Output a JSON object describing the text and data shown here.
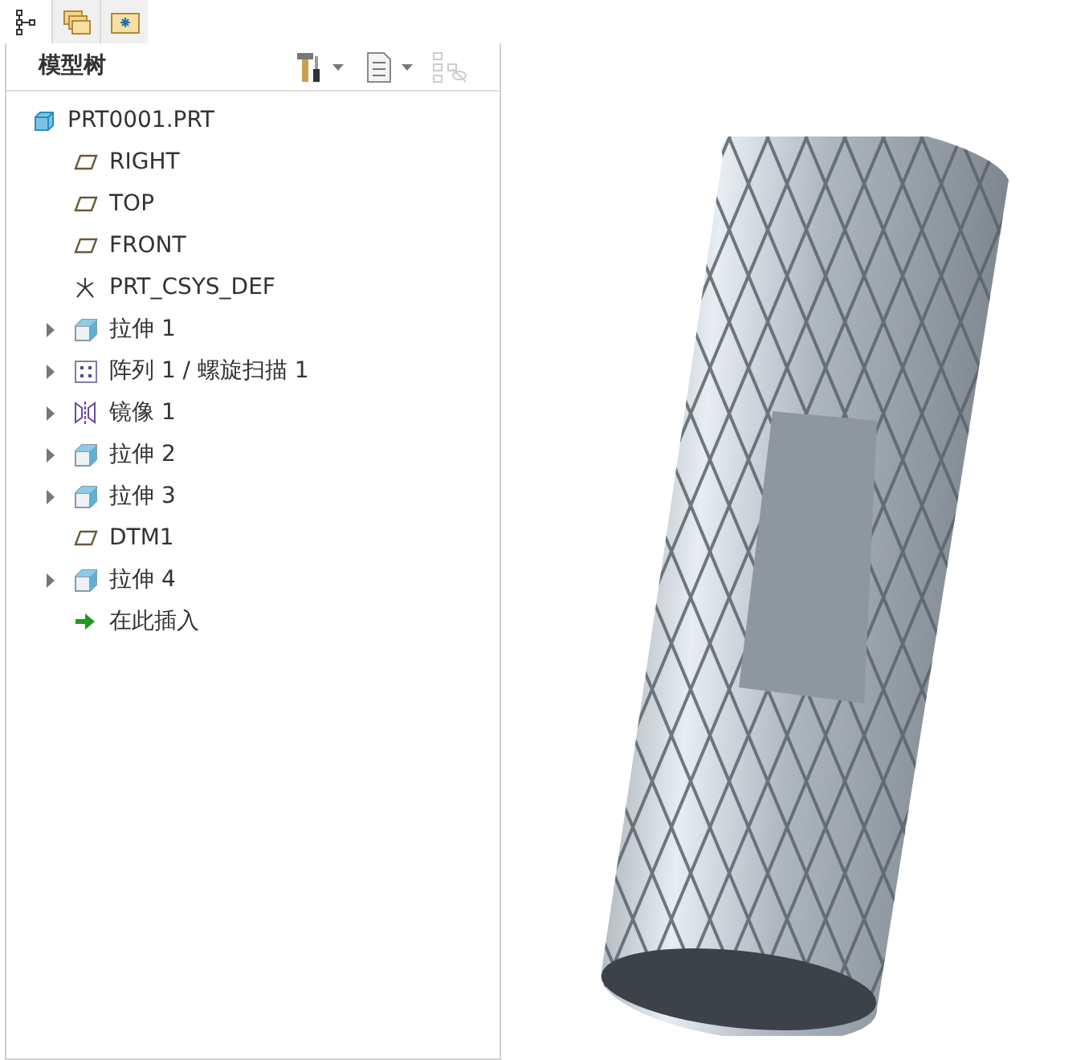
{
  "panel_tabs": [
    {
      "kind": "tree",
      "selected": true
    },
    {
      "kind": "layers",
      "selected": false
    },
    {
      "kind": "favorites",
      "selected": false
    }
  ],
  "model_tree": {
    "title": "模型树",
    "items": [
      {
        "kind": "part",
        "label": "PRT0001.PRT",
        "children": [
          {
            "kind": "plane",
            "label": "RIGHT"
          },
          {
            "kind": "plane",
            "label": "TOP"
          },
          {
            "kind": "plane",
            "label": "FRONT"
          },
          {
            "kind": "csys",
            "label": "PRT_CSYS_DEF"
          },
          {
            "kind": "extrude",
            "label": "拉伸 1",
            "expanded": false
          },
          {
            "kind": "pattern",
            "label": "阵列 1 / 螺旋扫描 1",
            "expanded": false
          },
          {
            "kind": "mirror",
            "label": "镜像 1",
            "expanded": false
          },
          {
            "kind": "extrude",
            "label": "拉伸 2",
            "expanded": false
          },
          {
            "kind": "extrude",
            "label": "拉伸 3",
            "expanded": false
          },
          {
            "kind": "plane",
            "label": "DTM1"
          },
          {
            "kind": "extrude",
            "label": "拉伸 4",
            "expanded": false
          },
          {
            "kind": "insert",
            "label": "在此插入"
          }
        ]
      }
    ]
  }
}
